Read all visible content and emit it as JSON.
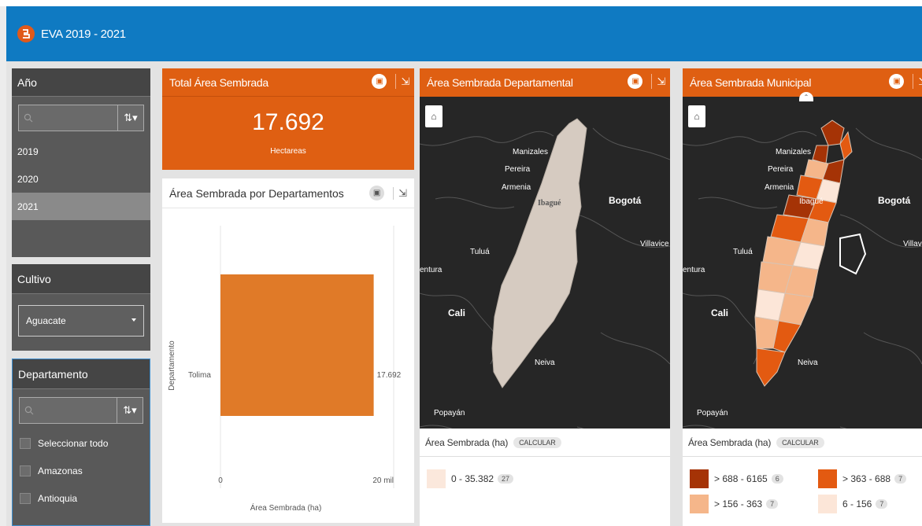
{
  "app": {
    "title": "EVA 2019 - 2021"
  },
  "filters": {
    "year": {
      "title": "Año",
      "items": [
        "2019",
        "2020",
        "2021"
      ],
      "selected": "2021"
    },
    "crop": {
      "title": "Cultivo",
      "value": "Aguacate"
    },
    "department": {
      "title": "Departamento",
      "items": [
        "Seleccionar todo",
        "Amazonas",
        "Antioquia"
      ]
    }
  },
  "total": {
    "title": "Total Área Sembrada",
    "value": "17.692",
    "unit": "Hectareas"
  },
  "bar": {
    "title": "Área Sembrada por Departamentos"
  },
  "chart_data": {
    "type": "bar",
    "orientation": "horizontal",
    "categories": [
      "Tolima"
    ],
    "values": [
      17692
    ],
    "data_labels": [
      "17.692"
    ],
    "xlabel": "Área Sembrada (ha)",
    "ylabel": "Departamento",
    "xticks": [
      "0",
      "20 mil"
    ],
    "xlim": [
      0,
      20000
    ],
    "bar_color": "#e07a28"
  },
  "dept_map": {
    "title": "Área Sembrada Departamental",
    "labels": {
      "manizales": "Manizales",
      "pereira": "Pereira",
      "armenia": "Armenia",
      "ibague": "Ibagué",
      "bogota": "Bogotá",
      "villavicencio": "Villavice",
      "tulua": "Tuluá",
      "buenaventura": "entura",
      "cali": "Cali",
      "neiva": "Neiva",
      "popayan": "Popayán"
    },
    "legend": {
      "title": "Área Sembrada (ha)",
      "button": "CALCULAR",
      "classes": [
        {
          "label": "0 - 35.382",
          "count": "27",
          "color": "#fbe8dc"
        }
      ]
    }
  },
  "muni_map": {
    "title": "Área Sembrada Municipal",
    "labels": {
      "manizales": "Manizales",
      "pereira": "Pereira",
      "armenia": "Armenia",
      "ibague": "Ibagué",
      "bogota": "Bogotá",
      "villavicencio": "Villav",
      "tulua": "Tuluá",
      "buenaventura": "entura",
      "cali": "Cali",
      "neiva": "Neiva",
      "popayan": "Popayán"
    },
    "legend": {
      "title": "Área Sembrada (ha)",
      "button": "CALCULAR",
      "classes": [
        {
          "label": "> 688 - 6165",
          "count": "6",
          "color": "#a53306"
        },
        {
          "label": "> 363 - 688",
          "count": "7",
          "color": "#e35a11"
        },
        {
          "label": "> 156 - 363",
          "count": "7",
          "color": "#f5b68a"
        },
        {
          "label": "6 - 156",
          "count": "7",
          "color": "#fce6d8"
        }
      ]
    }
  }
}
